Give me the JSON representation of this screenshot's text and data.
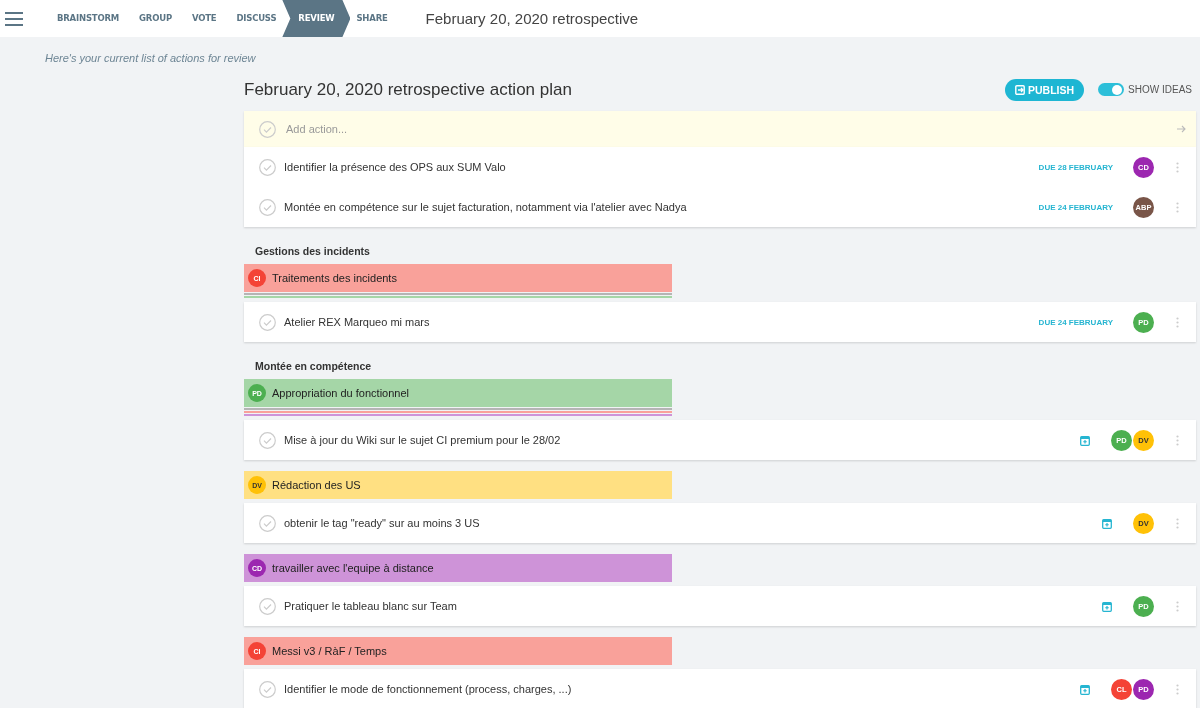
{
  "stages": [
    {
      "label": "BRAINSTORM",
      "selected": false
    },
    {
      "label": "GROUP",
      "selected": false
    },
    {
      "label": "VOTE",
      "selected": false
    },
    {
      "label": "DISCUSS",
      "selected": false
    },
    {
      "label": "REVIEW",
      "selected": true
    },
    {
      "label": "SHARE",
      "selected": false
    }
  ],
  "title": "February 20, 2020 retrospective",
  "subtitle": "Here's your current list of actions for review",
  "plan": {
    "title": "February 20, 2020 retrospective action plan",
    "publish": "PUBLISH",
    "show_ideas": {
      "label": "SHOW IDEAS",
      "on": true
    }
  },
  "add_action": {
    "placeholder": "Add action..."
  },
  "actions": [
    {
      "text": "Identifier la présence des OPS aux SUM Valo",
      "kind": "due",
      "due": "DUE 28 FEBRUARY",
      "assignees": [
        {
          "initials": "CD",
          "color": "#9c27b0"
        }
      ]
    },
    {
      "text": "Montée en compétence sur le sujet facturation, notamment via l'atelier avec Nadya",
      "kind": "due",
      "due": "DUE 24 FEBRUARY",
      "assignees": [
        {
          "initials": "ABP",
          "color": "#795548"
        }
      ]
    }
  ],
  "groups": [
    {
      "heading": "Gestions des incidents",
      "idea": {
        "avatar": {
          "initials": "CI",
          "color": "#f44336"
        },
        "text": "Traitements des incidents",
        "color": "#f9a19a"
      },
      "stack": [
        {
          "color": "#b5b5b5"
        },
        {
          "color": "#a5d6a7"
        }
      ],
      "actions": [
        {
          "text": "Atelier REX Marqueo mi mars",
          "kind": "due",
          "due": "DUE 24 FEBRUARY",
          "assignees": [
            {
              "initials": "PD",
              "color": "#4caf50"
            }
          ]
        }
      ]
    },
    {
      "heading": "Montée en compétence",
      "idea": {
        "avatar": {
          "initials": "PD",
          "color": "#4caf50"
        },
        "text": "Appropriation du fonctionnel",
        "color": "#a5d6a7"
      },
      "stack": [
        {
          "color": "#b5b5b5"
        },
        {
          "color": "#f9a19a"
        },
        {
          "color": "#ce93d8"
        }
      ],
      "actions": [
        {
          "text": "Mise à jour du Wiki sur le sujet CI premium pour le 28/02",
          "kind": "undated",
          "assignees": [
            {
              "initials": "PD",
              "color": "#4caf50"
            },
            {
              "initials": "DV",
              "color": "#ffc107"
            }
          ]
        }
      ]
    },
    {
      "idea": {
        "avatar": {
          "initials": "DV",
          "color": "#ffc107"
        },
        "text": "Rédaction des US",
        "color": "#ffe082"
      },
      "actions": [
        {
          "text": "obtenir le tag \"ready\" sur au moins 3 US",
          "kind": "undated",
          "assignees": [
            {
              "initials": "DV",
              "color": "#ffc107"
            }
          ]
        }
      ]
    },
    {
      "idea": {
        "avatar": {
          "initials": "CD",
          "color": "#9c27b0"
        },
        "text": "travailler avec l'equipe à distance",
        "color": "#ce93d8"
      },
      "actions": [
        {
          "text": "Pratiquer le tableau blanc sur Team",
          "kind": "undated",
          "assignees": [
            {
              "initials": "PD",
              "color": "#4caf50"
            }
          ]
        }
      ]
    },
    {
      "idea": {
        "avatar": {
          "initials": "CI",
          "color": "#f44336"
        },
        "text": "Messi v3 / RàF / Temps",
        "color": "#f9a19a"
      },
      "actions": [
        {
          "text": "Identifier le mode de fonctionnement (process, charges, ...)",
          "kind": "undated",
          "assignees": [
            {
              "initials": "CL",
              "color": "#f44336"
            },
            {
              "initials": "PD",
              "color": "#9c27b0"
            }
          ]
        }
      ]
    }
  ]
}
